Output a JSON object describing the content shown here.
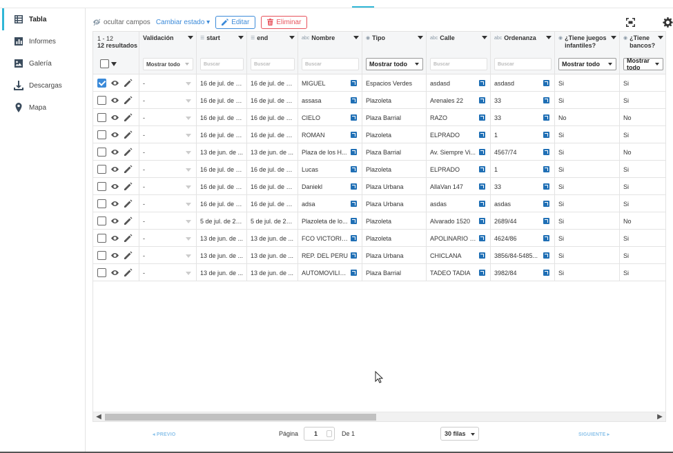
{
  "sidebar": {
    "items": [
      {
        "label": "Tabla",
        "icon": "table-icon"
      },
      {
        "label": "Informes",
        "icon": "chart-icon"
      },
      {
        "label": "Galería",
        "icon": "image-icon"
      },
      {
        "label": "Descargas",
        "icon": "download-icon"
      },
      {
        "label": "Mapa",
        "icon": "map-pin-icon"
      }
    ]
  },
  "toolbar": {
    "hide_fields": "ocultar campos",
    "change_state": "Cambiar estado ▾",
    "edit": "Editar",
    "delete": "Eliminar"
  },
  "colors": {
    "accent": "#2fb6d6",
    "primary": "#3b8ad9",
    "danger": "#e7505a",
    "link": "#1f6fb5"
  },
  "table": {
    "range": "1 - 12",
    "results": "12 resultados",
    "columns": [
      {
        "label": "Validación",
        "type": "",
        "filter": "Mostrar todo",
        "filter_kind": "select"
      },
      {
        "label": "start",
        "type": "date",
        "filter": "Buscar",
        "filter_kind": "search"
      },
      {
        "label": "end",
        "type": "date",
        "filter": "Buscar",
        "filter_kind": "search"
      },
      {
        "label": "Nombre",
        "type": "abc",
        "filter": "Buscar",
        "filter_kind": "search"
      },
      {
        "label": "Tipo",
        "type": "select",
        "filter": "Mostrar todo",
        "filter_kind": "select2"
      },
      {
        "label": "Calle",
        "type": "abc",
        "filter": "Buscar",
        "filter_kind": "search"
      },
      {
        "label": "Ordenanza",
        "type": "abc",
        "filter": "Buscar",
        "filter_kind": "search"
      },
      {
        "label": "¿Tiene juegos infantiles?",
        "type": "select",
        "filter": "Mostrar todo",
        "filter_kind": "select2"
      },
      {
        "label": "¿Tiene bancos?",
        "type": "select",
        "filter": "Mostrar todo",
        "filter_kind": "select2"
      }
    ],
    "rows": [
      {
        "checked": true,
        "cells": [
          "-",
          "16 de jul. de 2...",
          "16 de jul. de 2...",
          "MIGUEL",
          "Espacios Verdes",
          "asdasd",
          "asdasd",
          "Si",
          "Si"
        ]
      },
      {
        "checked": false,
        "cells": [
          "-",
          "16 de jul. de 2...",
          "16 de jul. de 2...",
          "assasa",
          "Plazoleta",
          "Arenales 22",
          "33",
          "Si",
          "Si"
        ]
      },
      {
        "checked": false,
        "cells": [
          "-",
          "16 de jul. de 2...",
          "16 de jul. de 2...",
          "CIELO",
          "Plaza Barrial",
          "RAZO",
          "33",
          "No",
          "No"
        ]
      },
      {
        "checked": false,
        "cells": [
          "-",
          "16 de jul. de 2...",
          "16 de jul. de 2...",
          "ROMAN",
          "Plazoleta",
          "ELPRADO",
          "1",
          "Si",
          "Si"
        ]
      },
      {
        "checked": false,
        "cells": [
          "-",
          "13 de jun. de ...",
          "13 de jun. de ...",
          "Plaza de los H...",
          "Plaza Barrial",
          "Av. Siempre Vi...",
          "4567/74",
          "Si",
          "No"
        ]
      },
      {
        "checked": false,
        "cells": [
          "-",
          "16 de jul. de 2...",
          "16 de jul. de 2...",
          "Lucas",
          "Plazoleta",
          "ELPRADO",
          "1",
          "Si",
          "Si"
        ]
      },
      {
        "checked": false,
        "cells": [
          "-",
          "16 de jul. de 2...",
          "16 de jul. de 2...",
          "Daniekl",
          "Plaza Urbana",
          "AllaVan 147",
          "33",
          "Si",
          "Si"
        ]
      },
      {
        "checked": false,
        "cells": [
          "-",
          "16 de jul. de 2...",
          "16 de jul. de 2...",
          "adsa",
          "Plaza Urbana",
          "asdas",
          "asdas",
          "Si",
          "Si"
        ]
      },
      {
        "checked": false,
        "cells": [
          "-",
          "5 de jul. de 20...",
          "5 de jul. de 20...",
          "Plazoleta de lo...",
          "Plazoleta",
          "Alvarado 1520",
          "2689/44",
          "Si",
          "No"
        ]
      },
      {
        "checked": false,
        "cells": [
          "-",
          "13 de jun. de ...",
          "13 de jun. de ...",
          "FCO VICTORIN...",
          "Plazoleta",
          "APOLINARIO F...",
          "4624/86",
          "Si",
          "Si"
        ]
      },
      {
        "checked": false,
        "cells": [
          "-",
          "13 de jun. de ...",
          "13 de jun. de ...",
          "REP. DEL PERU",
          "Plaza Urbana",
          "CHICLANA",
          "3856/84-5485...",
          "Si",
          "Si"
        ]
      },
      {
        "checked": false,
        "cells": [
          "-",
          "13 de jun. de ...",
          "13 de jun. de ...",
          "AUTOMOVILIS...",
          "Plaza Barrial",
          "TADEO TADIA",
          "3982/84",
          "Si",
          "Si"
        ]
      }
    ]
  },
  "pagination": {
    "prev": "PREVIO",
    "page_label": "Página",
    "page_value": "1",
    "of_label": "De 1",
    "rows_per_page": "30 filas",
    "next": "SIGUIENTE"
  }
}
